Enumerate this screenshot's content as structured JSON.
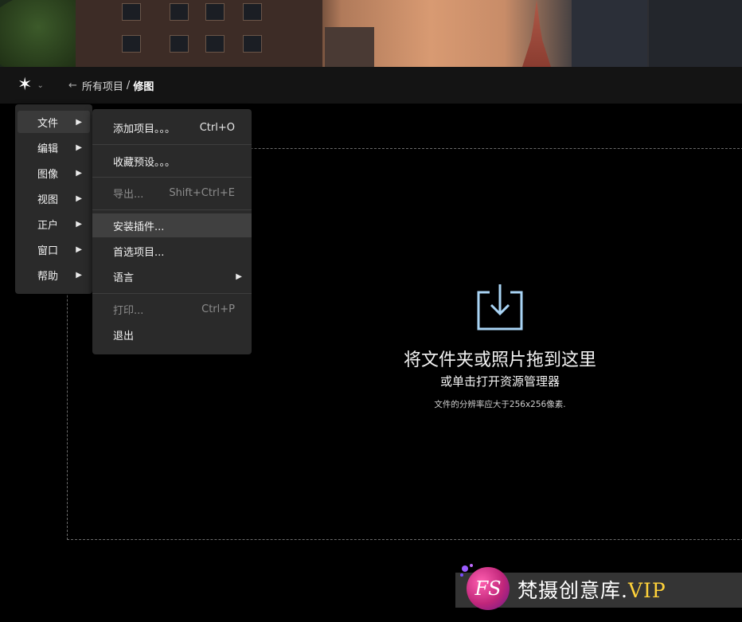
{
  "header": {
    "breadcrumb": {
      "all": "所有项目",
      "separator": "/",
      "current": "修图"
    }
  },
  "main_menu": {
    "items": [
      {
        "label": "文件"
      },
      {
        "label": "编辑"
      },
      {
        "label": "图像"
      },
      {
        "label": "视图"
      },
      {
        "label": "正户"
      },
      {
        "label": "窗口"
      },
      {
        "label": "帮助"
      }
    ]
  },
  "file_menu": {
    "items": [
      {
        "label": "添加项目。。。",
        "shortcut": "Ctrl+O"
      },
      {
        "label": "收藏预设。。。",
        "shortcut": ""
      },
      {
        "label": "导出...",
        "shortcut": "Shift+Ctrl+E"
      },
      {
        "label": "安装插件...",
        "shortcut": ""
      },
      {
        "label": "首选项目...",
        "shortcut": ""
      },
      {
        "label": "语言",
        "shortcut": ""
      },
      {
        "label": "打印...",
        "shortcut": "Ctrl+P"
      },
      {
        "label": "退出",
        "shortcut": ""
      }
    ]
  },
  "drop_zone": {
    "title": "将文件夹或照片拖到这里",
    "link": "或单击打开资源管理器",
    "note": "文件的分辨率应大于256x256像素."
  },
  "watermark": {
    "brand": "梵摄创意库.",
    "suffix": "VIP",
    "logo_text": "FS"
  },
  "colors": {
    "accent_icon": "#a9d4f5",
    "menu_bg": "#2a2a2a",
    "hover_bg": "#404040"
  }
}
